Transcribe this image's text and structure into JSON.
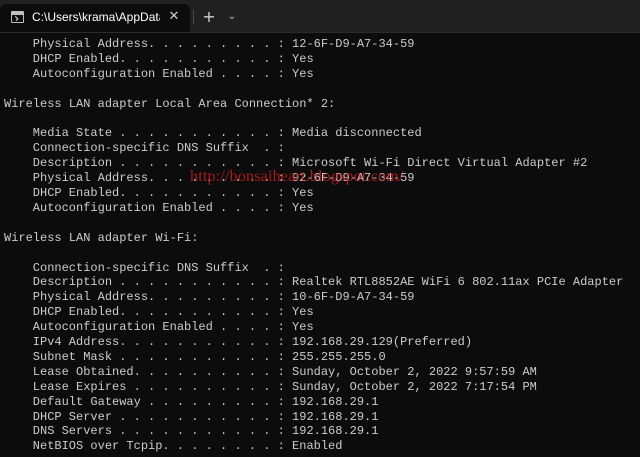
{
  "tab": {
    "title": "C:\\Users\\krama\\AppData\\Roa",
    "icon": "terminal-icon",
    "close": "✕",
    "new_tab": "+",
    "dropdown": "⌄"
  },
  "watermark": "http://bonsaiheart.blogspot.com/",
  "lines": [
    "    Physical Address. . . . . . . . . : 12-6F-D9-A7-34-59",
    "    DHCP Enabled. . . . . . . . . . . : Yes",
    "    Autoconfiguration Enabled . . . . : Yes",
    "",
    "Wireless LAN adapter Local Area Connection* 2:",
    "",
    "    Media State . . . . . . . . . . . : Media disconnected",
    "    Connection-specific DNS Suffix  . :",
    "    Description . . . . . . . . . . . : Microsoft Wi-Fi Direct Virtual Adapter #2",
    "    Physical Address. . . . . . . . . : 92-6F-D9-A7-34-59",
    "    DHCP Enabled. . . . . . . . . . . : Yes",
    "    Autoconfiguration Enabled . . . . : Yes",
    "",
    "Wireless LAN adapter Wi-Fi:",
    "",
    "    Connection-specific DNS Suffix  . :",
    "    Description . . . . . . . . . . . : Realtek RTL8852AE WiFi 6 802.11ax PCIe Adapter",
    "    Physical Address. . . . . . . . . : 10-6F-D9-A7-34-59",
    "    DHCP Enabled. . . . . . . . . . . : Yes",
    "    Autoconfiguration Enabled . . . . : Yes",
    "    IPv4 Address. . . . . . . . . . . : 192.168.29.129(Preferred)",
    "    Subnet Mask . . . . . . . . . . . : 255.255.255.0",
    "    Lease Obtained. . . . . . . . . . : Sunday, October 2, 2022 9:57:59 AM",
    "    Lease Expires . . . . . . . . . . : Sunday, October 2, 2022 7:17:54 PM",
    "    Default Gateway . . . . . . . . . : 192.168.29.1",
    "    DHCP Server . . . . . . . . . . . : 192.168.29.1",
    "    DNS Servers . . . . . . . . . . . : 192.168.29.1",
    "    NetBIOS over Tcpip. . . . . . . . : Enabled"
  ]
}
